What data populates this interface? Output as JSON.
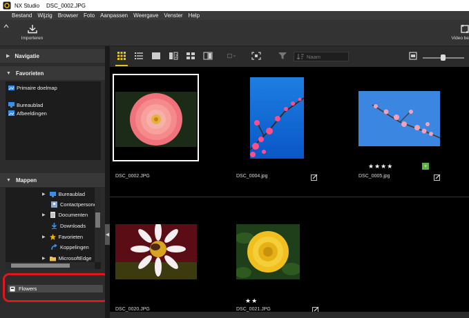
{
  "window": {
    "app_name": "NX Studio",
    "file_name": "DSC_0002.JPG"
  },
  "menu": [
    "Bestand",
    "Wijzig",
    "Browser",
    "Foto",
    "Aanpassen",
    "Weergave",
    "Venster",
    "Help"
  ],
  "toolbar": {
    "import_label": "Importeren",
    "video_label": "Video be"
  },
  "sidebar": {
    "navigation_label": "Navigatie",
    "favorites_label": "Favorieten",
    "favorites_items": [
      "Primaire doelmap",
      "Bureaublad",
      "Afbeeldingen"
    ],
    "folders_label": "Mappen",
    "folder_items": [
      "Bureaublad",
      "Contactpersonen",
      "Documenten",
      "Downloads",
      "Favorieten",
      "Koppelingen",
      "MicrosoftEdge"
    ],
    "album_item": "Flowers"
  },
  "content_toolbar": {
    "filter_placeholder": "Naam"
  },
  "thumbnails": [
    {
      "name": "DSC_0002.JPG",
      "stars": "",
      "selected": true
    },
    {
      "name": "DSC_0004.jpg",
      "stars": ""
    },
    {
      "name": "DSC_0005.jpg",
      "stars": "★★★★",
      "badge": "+"
    },
    {
      "name": "DSC_0020.JPG",
      "stars": ""
    },
    {
      "name": "DSC_0021.JPG",
      "stars": "★★"
    }
  ],
  "colors": {
    "accent": "#e7c51c",
    "highlight_circle": "#e0161e",
    "badge_green": "#5bb540"
  }
}
